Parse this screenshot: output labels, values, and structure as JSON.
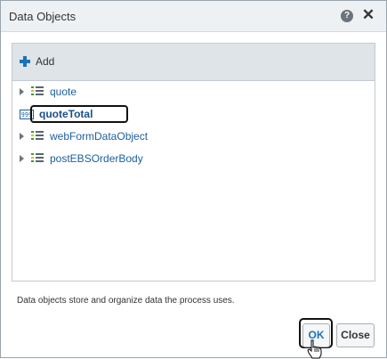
{
  "dialog": {
    "title": "Data Objects",
    "help_icon_glyph": "?",
    "close_icon_glyph": "✕"
  },
  "toolbar": {
    "add_label": "Add",
    "add_icon_color": "#1a73b8"
  },
  "tree": {
    "items": [
      {
        "label": "quote",
        "icon": "data-object-icon",
        "expandable": true
      },
      {
        "label": "quoteTotal",
        "icon": "number-icon",
        "icon_text": "999",
        "expandable": false,
        "selected": true
      },
      {
        "label": "webFormDataObject",
        "icon": "data-object-icon",
        "expandable": true
      },
      {
        "label": "postEBSOrderBody",
        "icon": "data-object-icon",
        "expandable": true
      }
    ]
  },
  "footer": {
    "description": "Data objects store and organize data the process uses."
  },
  "buttons": {
    "ok_label": "OK",
    "close_label": "Close"
  },
  "colors": {
    "link": "#1a5f9e",
    "accent": "#1a73b8",
    "icon_green": "#3a9b3a",
    "icon_yellow": "#e8b42a",
    "icon_gray": "#5a6470"
  }
}
